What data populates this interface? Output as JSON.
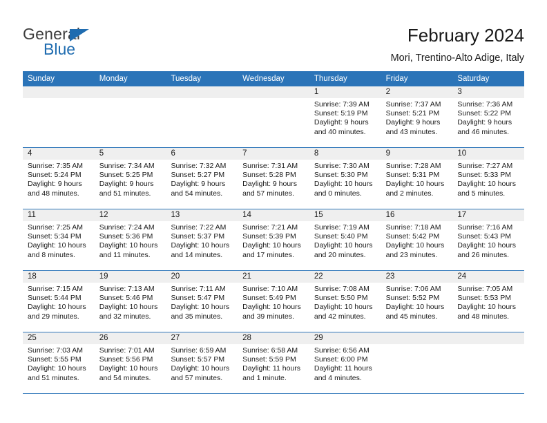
{
  "brand": {
    "name_top": "General",
    "name_bottom": "Blue",
    "triangle_color": "#1f6cb0",
    "text_color": "#3d3d3d"
  },
  "header": {
    "title": "February 2024",
    "subtitle": "Mori, Trentino-Alto Adige, Italy"
  },
  "colors": {
    "header_blue": "#2b74b8",
    "day_band_gray": "#efefef",
    "text": "#1a1a1a"
  },
  "weekday_headers": [
    "Sunday",
    "Monday",
    "Tuesday",
    "Wednesday",
    "Thursday",
    "Friday",
    "Saturday"
  ],
  "labels": {
    "sunrise_prefix": "Sunrise:",
    "sunset_prefix": "Sunset:",
    "daylight_prefix": "Daylight:"
  },
  "weeks": [
    [
      {
        "day": "",
        "l1": "",
        "l2": "",
        "l3": "",
        "l4": ""
      },
      {
        "day": "",
        "l1": "",
        "l2": "",
        "l3": "",
        "l4": ""
      },
      {
        "day": "",
        "l1": "",
        "l2": "",
        "l3": "",
        "l4": ""
      },
      {
        "day": "",
        "l1": "",
        "l2": "",
        "l3": "",
        "l4": ""
      },
      {
        "day": "1",
        "l1": "Sunrise: 7:39 AM",
        "l2": "Sunset: 5:19 PM",
        "l3": "Daylight: 9 hours",
        "l4": "and 40 minutes."
      },
      {
        "day": "2",
        "l1": "Sunrise: 7:37 AM",
        "l2": "Sunset: 5:21 PM",
        "l3": "Daylight: 9 hours",
        "l4": "and 43 minutes."
      },
      {
        "day": "3",
        "l1": "Sunrise: 7:36 AM",
        "l2": "Sunset: 5:22 PM",
        "l3": "Daylight: 9 hours",
        "l4": "and 46 minutes."
      }
    ],
    [
      {
        "day": "4",
        "l1": "Sunrise: 7:35 AM",
        "l2": "Sunset: 5:24 PM",
        "l3": "Daylight: 9 hours",
        "l4": "and 48 minutes."
      },
      {
        "day": "5",
        "l1": "Sunrise: 7:34 AM",
        "l2": "Sunset: 5:25 PM",
        "l3": "Daylight: 9 hours",
        "l4": "and 51 minutes."
      },
      {
        "day": "6",
        "l1": "Sunrise: 7:32 AM",
        "l2": "Sunset: 5:27 PM",
        "l3": "Daylight: 9 hours",
        "l4": "and 54 minutes."
      },
      {
        "day": "7",
        "l1": "Sunrise: 7:31 AM",
        "l2": "Sunset: 5:28 PM",
        "l3": "Daylight: 9 hours",
        "l4": "and 57 minutes."
      },
      {
        "day": "8",
        "l1": "Sunrise: 7:30 AM",
        "l2": "Sunset: 5:30 PM",
        "l3": "Daylight: 10 hours",
        "l4": "and 0 minutes."
      },
      {
        "day": "9",
        "l1": "Sunrise: 7:28 AM",
        "l2": "Sunset: 5:31 PM",
        "l3": "Daylight: 10 hours",
        "l4": "and 2 minutes."
      },
      {
        "day": "10",
        "l1": "Sunrise: 7:27 AM",
        "l2": "Sunset: 5:33 PM",
        "l3": "Daylight: 10 hours",
        "l4": "and 5 minutes."
      }
    ],
    [
      {
        "day": "11",
        "l1": "Sunrise: 7:25 AM",
        "l2": "Sunset: 5:34 PM",
        "l3": "Daylight: 10 hours",
        "l4": "and 8 minutes."
      },
      {
        "day": "12",
        "l1": "Sunrise: 7:24 AM",
        "l2": "Sunset: 5:36 PM",
        "l3": "Daylight: 10 hours",
        "l4": "and 11 minutes."
      },
      {
        "day": "13",
        "l1": "Sunrise: 7:22 AM",
        "l2": "Sunset: 5:37 PM",
        "l3": "Daylight: 10 hours",
        "l4": "and 14 minutes."
      },
      {
        "day": "14",
        "l1": "Sunrise: 7:21 AM",
        "l2": "Sunset: 5:39 PM",
        "l3": "Daylight: 10 hours",
        "l4": "and 17 minutes."
      },
      {
        "day": "15",
        "l1": "Sunrise: 7:19 AM",
        "l2": "Sunset: 5:40 PM",
        "l3": "Daylight: 10 hours",
        "l4": "and 20 minutes."
      },
      {
        "day": "16",
        "l1": "Sunrise: 7:18 AM",
        "l2": "Sunset: 5:42 PM",
        "l3": "Daylight: 10 hours",
        "l4": "and 23 minutes."
      },
      {
        "day": "17",
        "l1": "Sunrise: 7:16 AM",
        "l2": "Sunset: 5:43 PM",
        "l3": "Daylight: 10 hours",
        "l4": "and 26 minutes."
      }
    ],
    [
      {
        "day": "18",
        "l1": "Sunrise: 7:15 AM",
        "l2": "Sunset: 5:44 PM",
        "l3": "Daylight: 10 hours",
        "l4": "and 29 minutes."
      },
      {
        "day": "19",
        "l1": "Sunrise: 7:13 AM",
        "l2": "Sunset: 5:46 PM",
        "l3": "Daylight: 10 hours",
        "l4": "and 32 minutes."
      },
      {
        "day": "20",
        "l1": "Sunrise: 7:11 AM",
        "l2": "Sunset: 5:47 PM",
        "l3": "Daylight: 10 hours",
        "l4": "and 35 minutes."
      },
      {
        "day": "21",
        "l1": "Sunrise: 7:10 AM",
        "l2": "Sunset: 5:49 PM",
        "l3": "Daylight: 10 hours",
        "l4": "and 39 minutes."
      },
      {
        "day": "22",
        "l1": "Sunrise: 7:08 AM",
        "l2": "Sunset: 5:50 PM",
        "l3": "Daylight: 10 hours",
        "l4": "and 42 minutes."
      },
      {
        "day": "23",
        "l1": "Sunrise: 7:06 AM",
        "l2": "Sunset: 5:52 PM",
        "l3": "Daylight: 10 hours",
        "l4": "and 45 minutes."
      },
      {
        "day": "24",
        "l1": "Sunrise: 7:05 AM",
        "l2": "Sunset: 5:53 PM",
        "l3": "Daylight: 10 hours",
        "l4": "and 48 minutes."
      }
    ],
    [
      {
        "day": "25",
        "l1": "Sunrise: 7:03 AM",
        "l2": "Sunset: 5:55 PM",
        "l3": "Daylight: 10 hours",
        "l4": "and 51 minutes."
      },
      {
        "day": "26",
        "l1": "Sunrise: 7:01 AM",
        "l2": "Sunset: 5:56 PM",
        "l3": "Daylight: 10 hours",
        "l4": "and 54 minutes."
      },
      {
        "day": "27",
        "l1": "Sunrise: 6:59 AM",
        "l2": "Sunset: 5:57 PM",
        "l3": "Daylight: 10 hours",
        "l4": "and 57 minutes."
      },
      {
        "day": "28",
        "l1": "Sunrise: 6:58 AM",
        "l2": "Sunset: 5:59 PM",
        "l3": "Daylight: 11 hours",
        "l4": "and 1 minute."
      },
      {
        "day": "29",
        "l1": "Sunrise: 6:56 AM",
        "l2": "Sunset: 6:00 PM",
        "l3": "Daylight: 11 hours",
        "l4": "and 4 minutes."
      },
      {
        "day": "",
        "l1": "",
        "l2": "",
        "l3": "",
        "l4": ""
      },
      {
        "day": "",
        "l1": "",
        "l2": "",
        "l3": "",
        "l4": ""
      }
    ]
  ]
}
